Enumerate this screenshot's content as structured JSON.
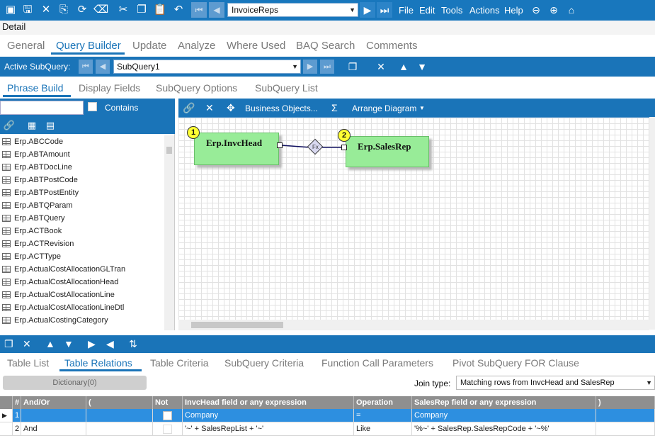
{
  "toolbar": {
    "query_name": "InvoiceReps",
    "menus": [
      "File",
      "Edit",
      "Tools",
      "Actions",
      "Help"
    ]
  },
  "section_label": "Detail",
  "main_tabs": [
    "General",
    "Query Builder",
    "Update",
    "Analyze",
    "Where Used",
    "BAQ Search",
    "Comments"
  ],
  "active_main_tab": "Query Builder",
  "subquery": {
    "label": "Active SubQuery:",
    "value": "SubQuery1"
  },
  "sub_tabs": [
    "Phrase Build",
    "Display Fields",
    "SubQuery Options",
    "SubQuery List"
  ],
  "active_sub_tab": "Phrase Build",
  "left_panel": {
    "search_value": "",
    "contains_label": "Contains",
    "tables": [
      "Erp.ABCCode",
      "Erp.ABTAmount",
      "Erp.ABTDocLine",
      "Erp.ABTPostCode",
      "Erp.ABTPostEntity",
      "Erp.ABTQParam",
      "Erp.ABTQuery",
      "Erp.ACTBook",
      "Erp.ACTRevision",
      "Erp.ACTType",
      "Erp.ActualCostAllocationGLTran",
      "Erp.ActualCostAllocationHead",
      "Erp.ActualCostAllocationLine",
      "Erp.ActualCostAllocationLineDtl",
      "Erp.ActualCostingCategory"
    ]
  },
  "diagram_tools": {
    "business_objects": "Business Objects...",
    "sigma": "Σ",
    "arrange": "Arrange Diagram"
  },
  "diagram": {
    "tables": [
      {
        "badge": "1",
        "name": "Erp.InvcHead"
      },
      {
        "badge": "2",
        "name": "Erp.SalesRep"
      }
    ],
    "relation_label": "Fx"
  },
  "bottom_tabs": [
    "Table List",
    "Table Relations",
    "Table Criteria",
    "SubQuery Criteria",
    "Function Call Parameters",
    "Pivot SubQuery FOR Clause"
  ],
  "active_bottom_tab": "Table Relations",
  "dictionary_button": "Dictionary(0)",
  "join": {
    "label": "Join type:",
    "value": "Matching rows from InvcHead and SalesRep"
  },
  "grid": {
    "headers": [
      "#",
      "And/Or",
      "(",
      "Not",
      "InvcHead field or any expression",
      "Operation",
      "SalesRep field or any expression",
      ")"
    ],
    "rows": [
      {
        "num": "1",
        "andor": "",
        "lparen": "",
        "left": "Company",
        "op": "=",
        "right": "Company",
        "rparen": ""
      },
      {
        "num": "2",
        "andor": "And",
        "lparen": "",
        "left": "'~' + SalesRepList + '~'",
        "op": "Like",
        "right": "'%~' + SalesRep.SalesRepCode + '~%'",
        "rparen": ""
      }
    ]
  }
}
